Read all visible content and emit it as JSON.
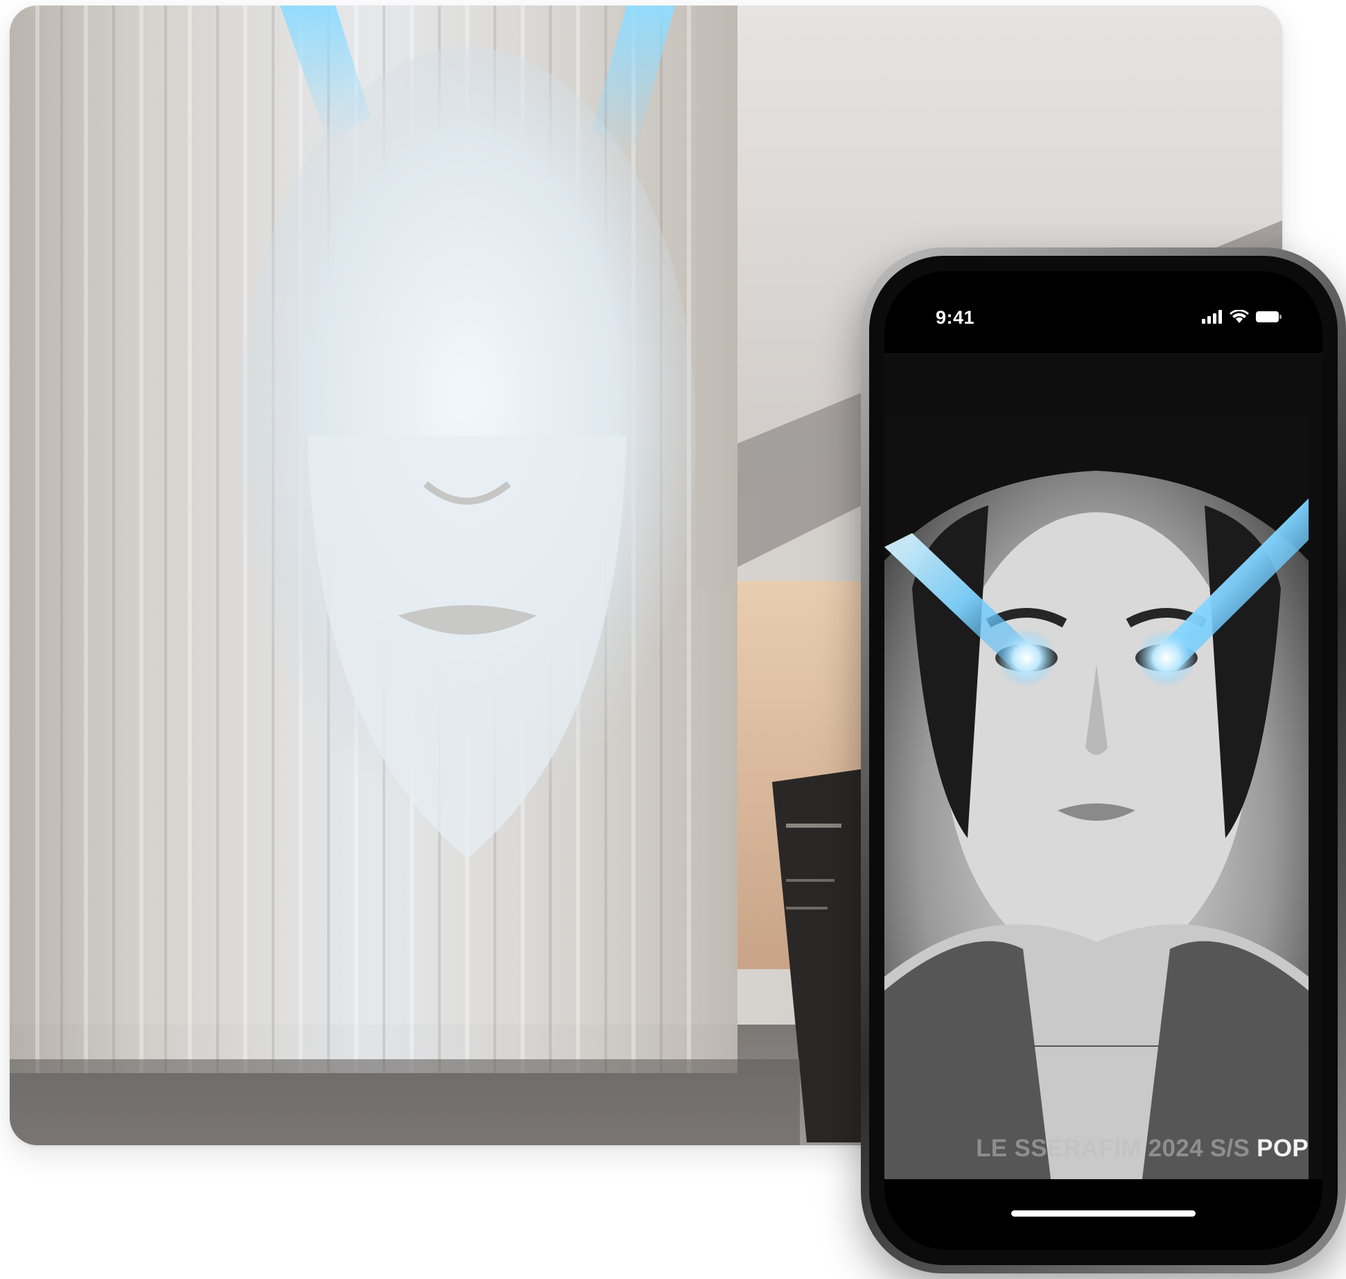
{
  "photo_card": {
    "description_icon": "projection-photo"
  },
  "phone": {
    "status_bar": {
      "time": "9:41",
      "icons": [
        "signal-icon",
        "wifi-icon",
        "battery-icon"
      ]
    },
    "story": {
      "caption_faded": "LE SSERAFIM 2024 S/S ",
      "caption_strong": "POP"
    }
  },
  "colors": {
    "laser_blue": "#7fd3ff",
    "phone_frame": "#2b2b2b",
    "screen_black": "#000000"
  }
}
